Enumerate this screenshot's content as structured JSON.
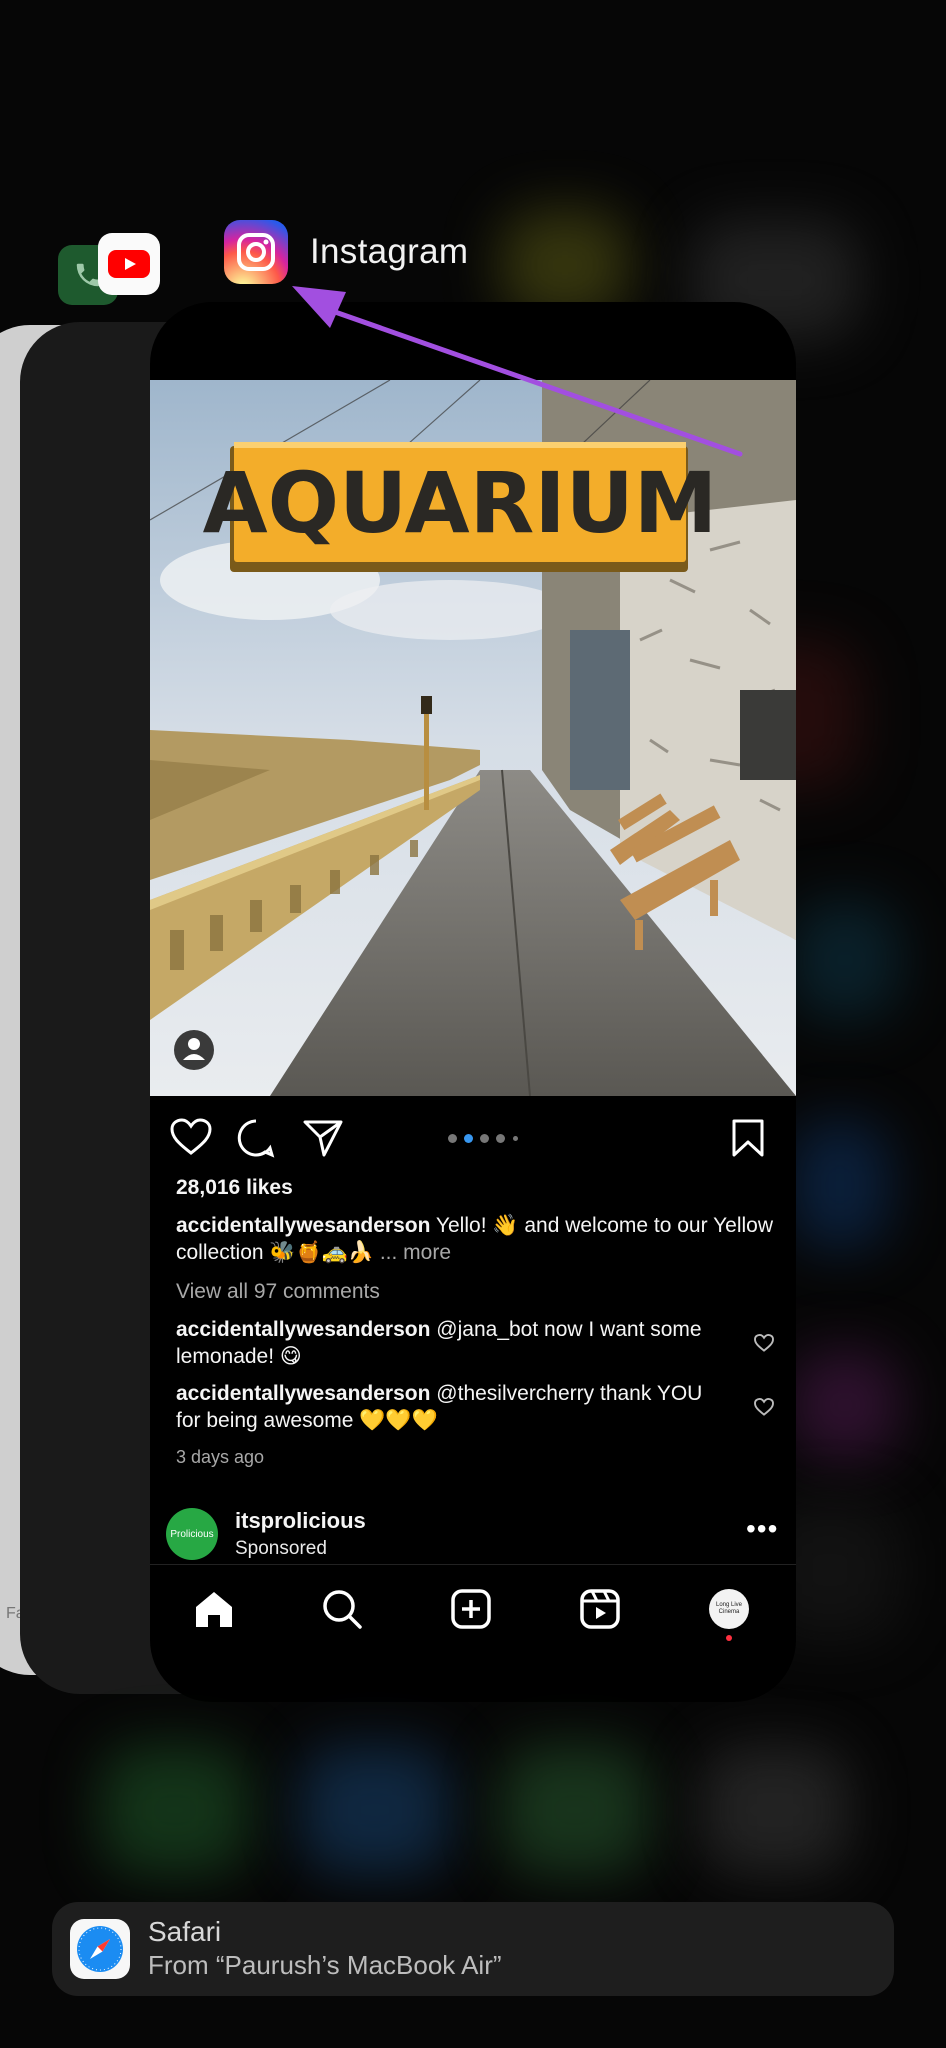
{
  "app_switcher": {
    "app_title": "Instagram",
    "side_label": "Fa"
  },
  "post": {
    "sign_text": "AQUARIUM",
    "likes": "28,016 likes",
    "caption_user": "accidentallywesanderson",
    "caption_text": "Yello! 👋 and welcome to our Yellow collection 🐝🍯🚕🍌",
    "caption_more": "... more",
    "view_comments": "View all 97 comments",
    "comments": [
      {
        "user": "accidentallywesanderson",
        "text": "@jana_bot now I want some lemonade! 😋"
      },
      {
        "user": "accidentallywesanderson",
        "text": "@thesilvercherry thank YOU for being awesome 💛💛💛"
      }
    ],
    "time_ago": "3 days ago",
    "carousel": {
      "count": 5,
      "active_index": 1
    }
  },
  "sponsored": {
    "avatar_text": "Prolicious",
    "username": "itsprolicious",
    "label": "Sponsored"
  },
  "profile_avatar_text": "Long Live Cinema",
  "handoff": {
    "title": "Safari",
    "subtitle": "From “Paurush’s MacBook Air”"
  },
  "colors": {
    "arrow": "#a24fe0",
    "accent_blue": "#3897f0",
    "notify_red": "#ff3040",
    "sign_yellow": "#f3ad2a"
  }
}
